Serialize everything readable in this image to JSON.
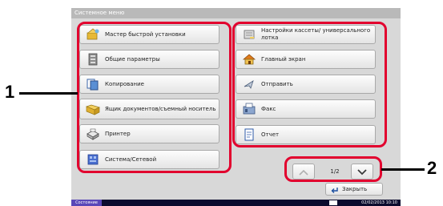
{
  "window": {
    "title": "Системное меню"
  },
  "menu_left": [
    {
      "label": "Мастер быстрой установки",
      "icon": "wizard-icon"
    },
    {
      "label": "Общие параметры",
      "icon": "general-settings-icon"
    },
    {
      "label": "Копирование",
      "icon": "copy-icon"
    },
    {
      "label": "Ящик документов/съемный носитель",
      "icon": "document-box-icon"
    },
    {
      "label": "Принтер",
      "icon": "printer-icon"
    },
    {
      "label": "Система/Сетевой",
      "icon": "system-network-icon"
    }
  ],
  "menu_right": [
    {
      "label": "Настройки кассеты/ универсального лотка",
      "icon": "cassette-icon"
    },
    {
      "label": "Главный экран",
      "icon": "home-icon"
    },
    {
      "label": "Отправить",
      "icon": "send-icon"
    },
    {
      "label": "Факс",
      "icon": "fax-icon"
    },
    {
      "label": "Отчет",
      "icon": "report-icon"
    }
  ],
  "pagination": {
    "page": "1/2"
  },
  "close_button": {
    "label": "Закрыть"
  },
  "status_bar": {
    "status_label": "Состояние",
    "datetime": "02/02/2013  10:10"
  },
  "callouts": {
    "one": "1",
    "two": "2"
  },
  "colors": {
    "accent_outline": "#e2002e",
    "status_button": "#5a47b8"
  }
}
